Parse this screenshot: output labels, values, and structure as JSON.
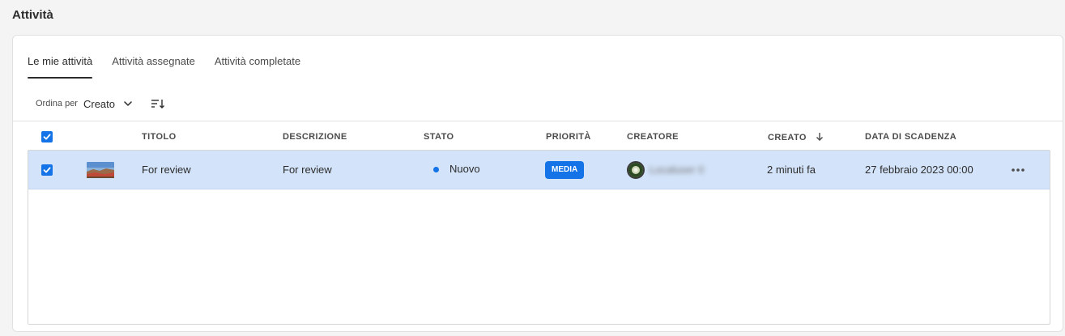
{
  "page": {
    "title": "Attività"
  },
  "tabs": [
    {
      "label": "Le mie attività",
      "active": true
    },
    {
      "label": "Attività assegnate",
      "active": false
    },
    {
      "label": "Attività completate",
      "active": false
    }
  ],
  "sort": {
    "label": "Ordina per",
    "value": "Creato",
    "order_icon": "sort-descending-icon"
  },
  "table": {
    "columns": [
      {
        "key": "title",
        "label": "TITOLO"
      },
      {
        "key": "description",
        "label": "DESCRIZIONE"
      },
      {
        "key": "status",
        "label": "STATO"
      },
      {
        "key": "priority",
        "label": "PRIORITÀ"
      },
      {
        "key": "creator",
        "label": "CREATORE"
      },
      {
        "key": "created",
        "label": "CREATO",
        "sorted": "descending"
      },
      {
        "key": "due",
        "label": "DATA DI SCADENZA"
      }
    ],
    "select_all_checked": true,
    "rows": [
      {
        "selected": true,
        "thumbnail": "landscape-thumbnail",
        "title": "For review",
        "description": "For review",
        "status": "Nuovo",
        "priority": "MEDIA",
        "creator": "Localuser 0",
        "created": "2 minuti fa",
        "due": "27 febbraio 2023 00:00"
      }
    ]
  },
  "colors": {
    "accent": "#1473e6",
    "selected_row": "#d3e3f9",
    "background": "#f4f4f4"
  }
}
